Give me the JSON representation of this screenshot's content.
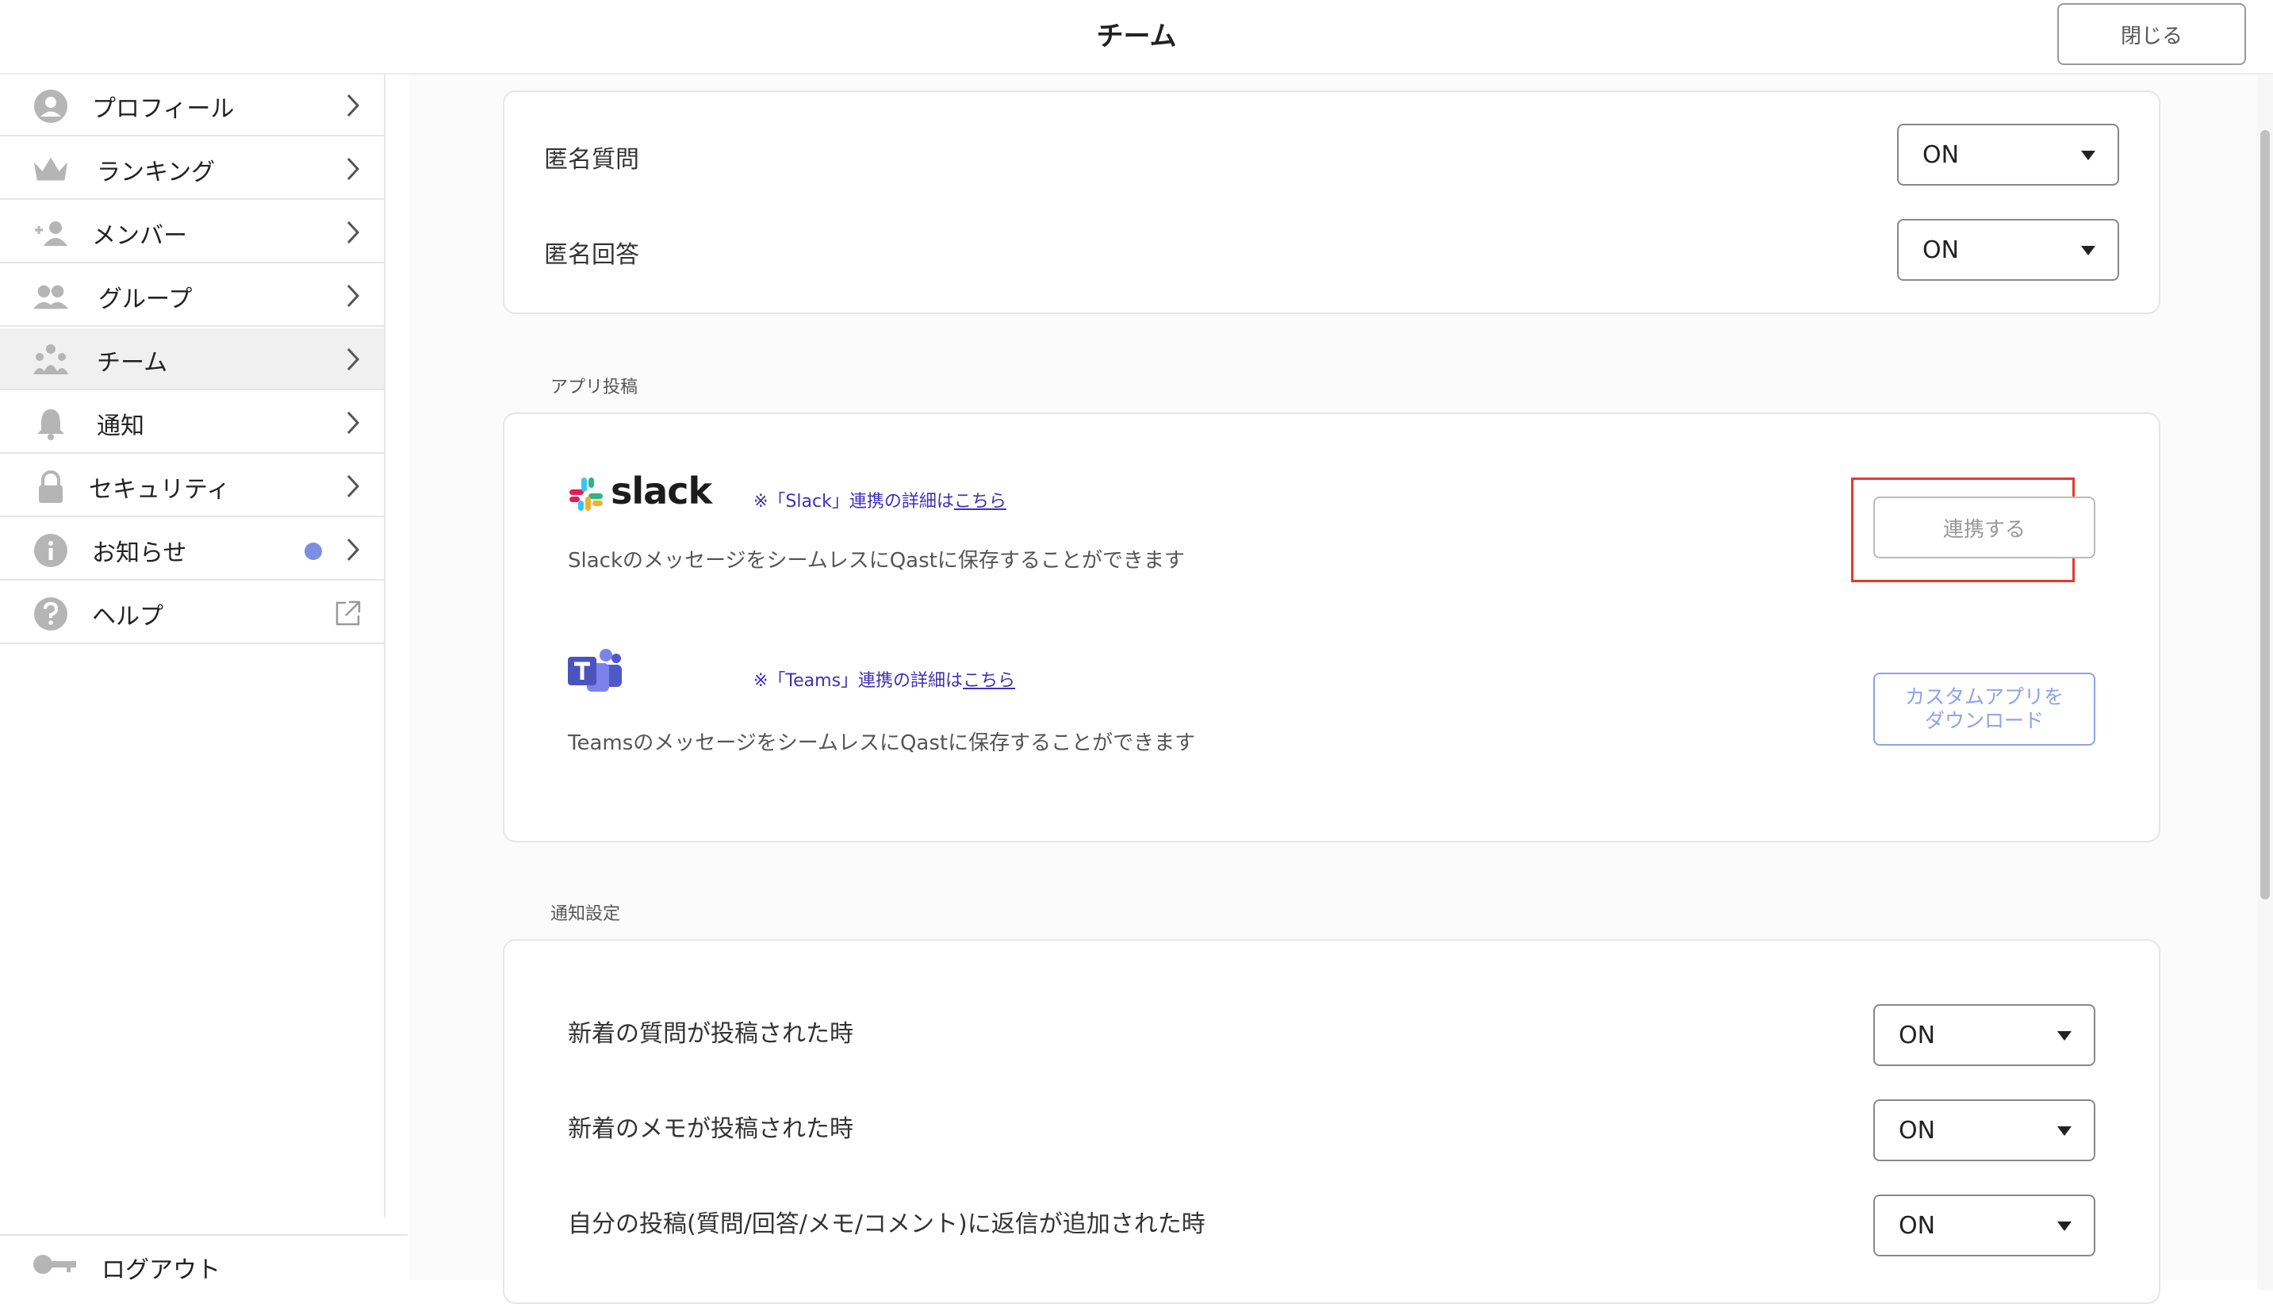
{
  "header": {
    "title": "チーム",
    "close_label": "閉じる"
  },
  "sidebar": {
    "items": [
      {
        "label": "プロフィール",
        "icon": "profile-icon"
      },
      {
        "label": "ランキング",
        "icon": "crown-icon"
      },
      {
        "label": "メンバー",
        "icon": "add-member-icon"
      },
      {
        "label": "グループ",
        "icon": "group-icon"
      },
      {
        "label": "チーム",
        "icon": "team-icon",
        "active": true
      },
      {
        "label": "通知",
        "icon": "bell-icon"
      },
      {
        "label": "セキュリティ",
        "icon": "lock-icon"
      },
      {
        "label": "お知らせ",
        "icon": "info-icon",
        "badge": true
      },
      {
        "label": "ヘルプ",
        "icon": "help-icon",
        "external": true
      }
    ],
    "logout_label": "ログアウト"
  },
  "anonymous": {
    "question_label": "匿名質問",
    "question_value": "ON",
    "answer_label": "匿名回答",
    "answer_value": "ON"
  },
  "app_post": {
    "section_title": "アプリ投稿",
    "slack": {
      "logo_text": "slack",
      "note_prefix": "※「Slack」連携の詳細は",
      "note_link": "こちら",
      "description": "SlackのメッセージをシームレスにQastに保存することができます",
      "button_label": "連携する"
    },
    "teams": {
      "note_prefix": "※「Teams」連携の詳細は",
      "note_link": "こちら",
      "description": "TeamsのメッセージをシームレスにQastに保存することができます",
      "button_line1": "カスタムアプリを",
      "button_line2": "ダウンロード"
    }
  },
  "notification": {
    "section_title": "通知設定",
    "rows": [
      {
        "label": "新着の質問が投稿された時",
        "value": "ON"
      },
      {
        "label": "新着のメモが投稿された時",
        "value": "ON"
      },
      {
        "label": "自分の投稿(質問/回答/メモ/コメント)に返信が追加された時",
        "value": "ON"
      }
    ]
  },
  "colors": {
    "accent": "#7c8ee0",
    "highlight": "#e53a2d",
    "link": "#3f2fb6"
  }
}
